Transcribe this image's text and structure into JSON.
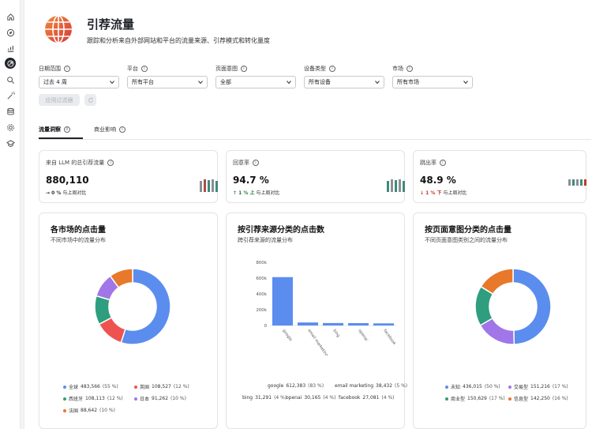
{
  "header": {
    "title": "引荐流量",
    "subtitle": "跟踪和分析来自外部网站和平台的流量来源、引荐模式和转化量度"
  },
  "filters": [
    {
      "label": "日期范围",
      "value": "过去 4 周"
    },
    {
      "label": "平台",
      "value": "所有平台"
    },
    {
      "label": "页面意图",
      "value": "全部"
    },
    {
      "label": "设备类型",
      "value": "所有设备"
    },
    {
      "label": "市场",
      "value": "所有市场"
    }
  ],
  "actions": {
    "apply_label": "应用过滤器"
  },
  "tabs": [
    {
      "label": "流量洞察",
      "active": true
    },
    {
      "label": "商业影响",
      "active": false
    }
  ],
  "kpis": [
    {
      "label": "来自 LLM 的总引荐流量",
      "value": "880,110",
      "delta_value": "→ 0 %",
      "delta_text": "与上周对比",
      "delta_color": "#333333",
      "spark": [
        "#8a8f94",
        "#b04a4a",
        "#3f8a7a",
        "#8a8f94",
        "#3f8a7a"
      ]
    },
    {
      "label": "回意率",
      "value": "94.7 %",
      "delta_value": "↑ 1 % 上",
      "delta_text": "与上周对比",
      "delta_color": "#2a7a3a",
      "spark": [
        "#3f8a7a",
        "#8a8f94",
        "#3f8a7a",
        "#8a8f94",
        "#3f8a7a"
      ]
    },
    {
      "label": "跳出率",
      "value": "48.9 %",
      "delta_value": "↓ 1 % 下",
      "delta_text": "与上周对比",
      "delta_color": "#c0392b",
      "spark": [
        "#8a8f94",
        "#3f8a7a",
        "#8a8f94",
        "#3f8a7a",
        "#c0392b"
      ]
    }
  ],
  "cards": {
    "market": {
      "title": "各市场的点击量",
      "subtitle": "不同市场中的流量分布"
    },
    "source": {
      "title": "按引荐来源分类的点击数",
      "subtitle": "跨引荐来源的流量分布"
    },
    "intent": {
      "title": "按页面意图分类的点击量",
      "subtitle": "不同页面意图类别之间的流量分布"
    }
  },
  "chart_data": [
    {
      "type": "pie",
      "title": "各市场的点击量",
      "slices": [
        {
          "name": "全球",
          "value": 483566,
          "pct": "55 %",
          "value_label": "483,566",
          "color": "#5b8def"
        },
        {
          "name": "英国",
          "value": 108527,
          "pct": "12 %",
          "value_label": "108,527",
          "color": "#ef5350"
        },
        {
          "name": "西班牙",
          "value": 108113,
          "pct": "12 %",
          "value_label": "108,113",
          "color": "#2e9e7e"
        },
        {
          "name": "日本",
          "value": 91262,
          "pct": "10 %",
          "value_label": "91,262",
          "color": "#a076e8"
        },
        {
          "name": "法国",
          "value": 88642,
          "pct": "10 %",
          "value_label": "88,642",
          "color": "#e8782a"
        }
      ]
    },
    {
      "type": "bar",
      "title": "按引荐来源分类的点击数",
      "categories": [
        "google",
        "email marketing",
        "bing",
        "openai",
        "facebook"
      ],
      "values": [
        612383,
        38432,
        31291,
        30165,
        27081
      ],
      "pct": [
        "83 %",
        "5 %",
        "4 %",
        "4 %",
        "4 %"
      ],
      "value_labels": [
        "612,383",
        "38,432",
        "31,291",
        "30,165",
        "27,081"
      ],
      "ylim": [
        0,
        800000
      ],
      "yticks": [
        "0",
        "200k",
        "400k",
        "600k",
        "800k"
      ],
      "color": "#5b8def"
    },
    {
      "type": "pie",
      "title": "按页面意图分类的点击量",
      "slices": [
        {
          "name": "未知",
          "value": 436015,
          "pct": "50 %",
          "value_label": "436,015",
          "color": "#5b8def"
        },
        {
          "name": "交易型",
          "value": 151216,
          "pct": "17 %",
          "value_label": "151,216",
          "color": "#a076e8"
        },
        {
          "name": "商业型",
          "value": 150629,
          "pct": "17 %",
          "value_label": "150,629",
          "color": "#2e9e7e"
        },
        {
          "name": "信息型",
          "value": 142250,
          "pct": "16 %",
          "value_label": "142,250",
          "color": "#e8782a"
        }
      ]
    }
  ]
}
